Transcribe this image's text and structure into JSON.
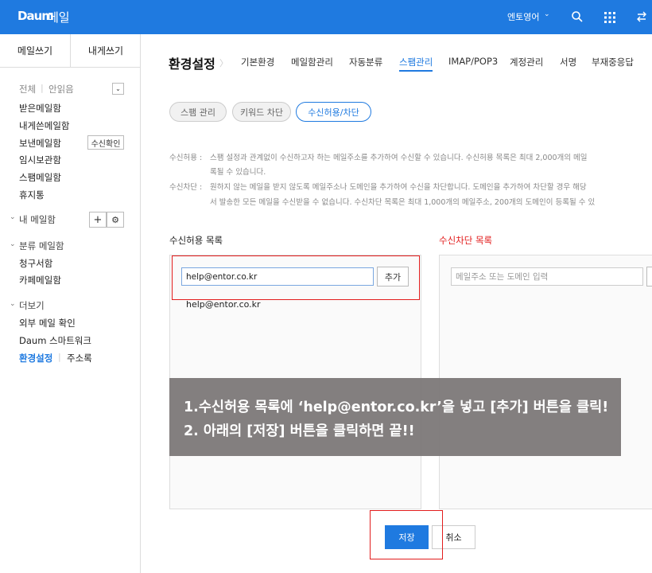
{
  "header": {
    "logo": "Daum",
    "app_title": "메일",
    "account": "엔토영어",
    "icons": [
      "chevron-down-icon",
      "search-icon",
      "grid-icon",
      "swap-icon"
    ]
  },
  "sidebar": {
    "compose_label": "메일쓰기",
    "self_compose_label": "내게쓰기",
    "filter_all": "전체",
    "filter_unread": "안읽음",
    "folders": [
      "받은메일함",
      "내게쓴메일함",
      "보낸메일함",
      "임시보관함",
      "스팸메일함",
      "휴지통"
    ],
    "receipt_check_label": "수신확인",
    "my_mailbox": "내 메일함",
    "category_mailbox": "분류 메일함",
    "category_items": [
      "청구서함",
      "카페메일함"
    ],
    "more": "더보기",
    "more_items": [
      "외부 메일 확인",
      "Daum 스마트워크"
    ],
    "settings_link": "환경설정",
    "address_book_link": "주소록"
  },
  "main": {
    "title": "환경설정",
    "tabs": [
      "기본환경",
      "메일함관리",
      "자동분류",
      "스팸관리",
      "IMAP/POP3",
      "계정관리",
      "서명",
      "부재중응답"
    ],
    "active_tab": "스팸관리",
    "sub_tabs": [
      "스팸 관리",
      "키워드 차단",
      "수신허용/차단"
    ],
    "active_sub_tab": "수신허용/차단",
    "desc_allow_label": "수신허용 :",
    "desc_allow_line1": "스팸 설정과 관계없이 수신하고자 하는 메일주소를 추가하여 수신할 수 있습니다. 수신허용 목록은 최대 2,000개의 메일",
    "desc_allow_line2": "록될 수 있습니다.",
    "desc_block_label": "수신차단 :",
    "desc_block_line1": "원하지 않는 메일을 받지 않도록 메일주소나 도메인을 추가하여 수신을 차단합니다. 도메인을 추가하여 차단할 경우 해당",
    "desc_block_line2": "서 발송한 모든 메일을 수신받을 수 없습니다. 수신차단 목록은 최대 1,000개의 메일주소, 200개의 도메인이 등록될 수 있",
    "allow_list_title": "수신허용 목록",
    "block_list_title": "수신차단 목록",
    "allow_input_value": "help@entor.co.kr",
    "add_button": "추가",
    "allow_list_items": [
      "help@entor.co.kr"
    ],
    "block_input_placeholder": "메일주소 또는 도메인 입력",
    "save_button": "저장",
    "cancel_button": "취소"
  },
  "overlay": {
    "line1": "1.수신허용 목록에 ‘help@entor.co.kr’을 넣고 [추가] 버튼을 클릭!",
    "line2": "2. 아래의 [저장] 버튼을 클릭하면 끝!!"
  },
  "colors": {
    "brand": "#1f7ae0",
    "highlight": "#e21d1d",
    "block_title": "#e21d1d"
  }
}
